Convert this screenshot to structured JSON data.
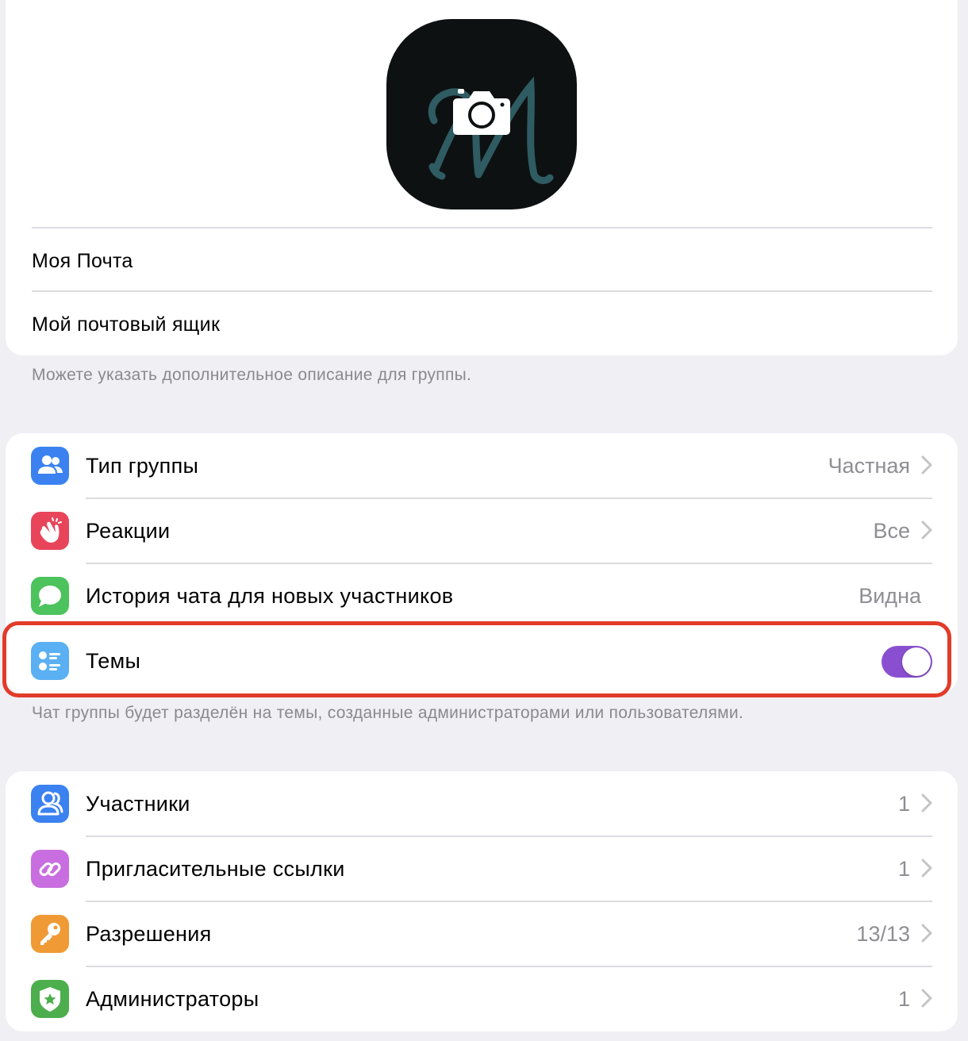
{
  "profile": {
    "name": "Моя Почта",
    "description": "Мой почтовый ящик",
    "description_hint": "Можете указать дополнительное описание для группы."
  },
  "settings": [
    {
      "label": "Тип группы",
      "value": "Частная",
      "icon": "people-icon",
      "color": "#3b82f0"
    },
    {
      "label": "Реакции",
      "value": "Все",
      "icon": "clapping-hands-icon",
      "color": "#e8455b"
    },
    {
      "label": "История чата для новых участников",
      "value": "Видна",
      "icon": "chat-bubble-icon",
      "color": "#4cc35c"
    },
    {
      "label": "Темы",
      "toggle_on": true,
      "icon": "topics-list-icon",
      "color": "#5ab0f3"
    }
  ],
  "topics_hint": "Чат группы будет разделён на темы, созданные администраторами или пользователями.",
  "members_section": [
    {
      "label": "Участники",
      "value": "1",
      "icon": "members-icon",
      "color": "#3b82f0"
    },
    {
      "label": "Пригласительные ссылки",
      "value": "1",
      "icon": "link-icon",
      "color": "#c86ee0"
    },
    {
      "label": "Разрешения",
      "value": "13/13",
      "icon": "key-icon",
      "color": "#f09a35"
    },
    {
      "label": "Администраторы",
      "value": "1",
      "icon": "admin-badge-icon",
      "color": "#4cae4c"
    }
  ],
  "colors": {
    "background": "#efeff4",
    "highlight": "#e23b2a",
    "toggle_on": "#8a4fd1"
  }
}
